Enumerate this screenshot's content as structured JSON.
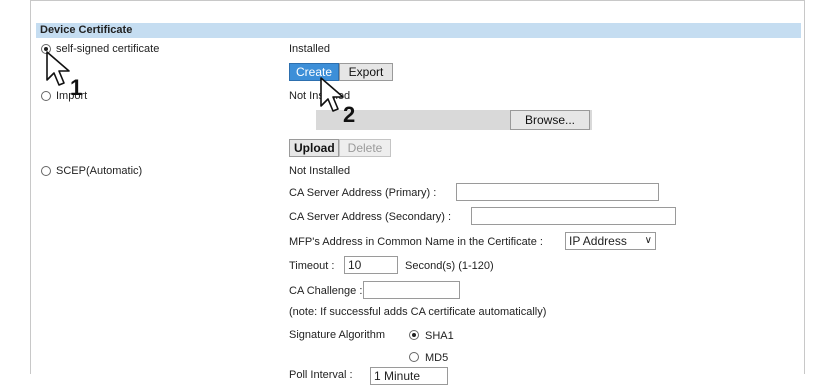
{
  "section": {
    "title": "Device Certificate"
  },
  "options": {
    "self_signed": {
      "label": "self-signed certificate",
      "status": "Installed"
    },
    "import": {
      "label": "Import",
      "status": "Not Installed"
    },
    "scep": {
      "label": "SCEP(Automatic)",
      "status": "Not Installed"
    }
  },
  "buttons": {
    "create": "Create",
    "export": "Export",
    "browse": "Browse...",
    "upload": "Upload",
    "delete": "Delete"
  },
  "scep_form": {
    "primary_label": "CA Server Address (Primary) :",
    "primary_value": "",
    "secondary_label": "CA Server Address (Secondary) :",
    "secondary_value": "",
    "mfp_address_label": "MFP's Address in Common Name in the Certificate :",
    "mfp_address_value": "IP Address",
    "timeout_label": "Timeout :",
    "timeout_value": "10",
    "timeout_unit": "Second(s) (1-120)",
    "challenge_label": "CA Challenge :",
    "challenge_value": "",
    "note": "(note: If successful adds CA certificate automatically)",
    "signature_label": "Signature Algorithm",
    "sha1": "SHA1",
    "md5": "MD5",
    "poll_label": "Poll Interval :",
    "poll_value": "1 Minute"
  },
  "callouts": {
    "step1": "1",
    "step2": "2"
  },
  "icons": {
    "cursor": "hand-pointer-icon",
    "dropdown": "chevron-down-icon"
  }
}
